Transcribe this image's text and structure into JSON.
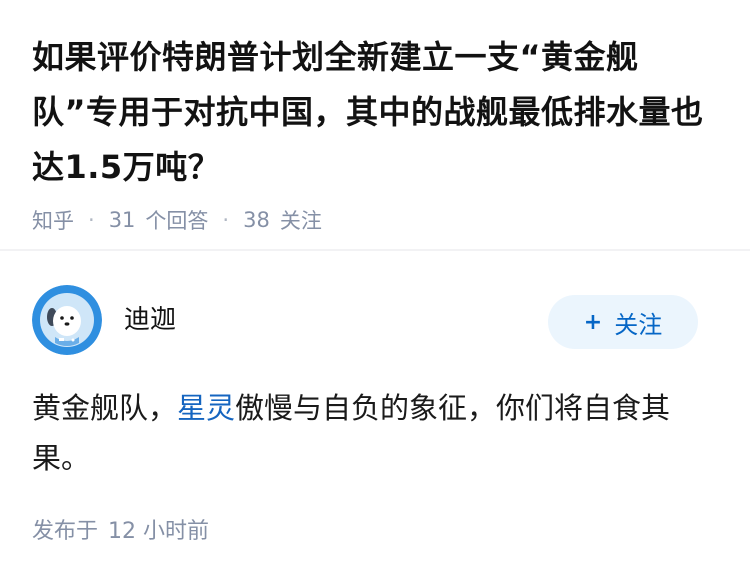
{
  "question": {
    "title": "如果评价特朗普计划全新建立一支“黄金舰队”专用于对抗中国，其中的战舰最低排水量也达1.5万吨？",
    "source": "知乎",
    "answer_count": "31",
    "answer_label": "个回答",
    "follow_count": "38",
    "follow_label": "关注"
  },
  "answer": {
    "author_name": "迪迦",
    "follow_button": "关注",
    "text_before_link": "黄金舰队，",
    "link_text": "星灵",
    "text_after_link": "傲慢与自负的象征，你们将自食其果。",
    "published_label": "发布于",
    "published_time": "12 小时前"
  },
  "colors": {
    "meta_gray": "#8590a6",
    "link_blue": "#1565c0",
    "button_bg": "#ebf5fd",
    "button_text": "#0566c6",
    "avatar_bg": "#2f8fe0"
  },
  "icons": {
    "plus": "plus-icon",
    "avatar": "avatar-robot-dog"
  }
}
